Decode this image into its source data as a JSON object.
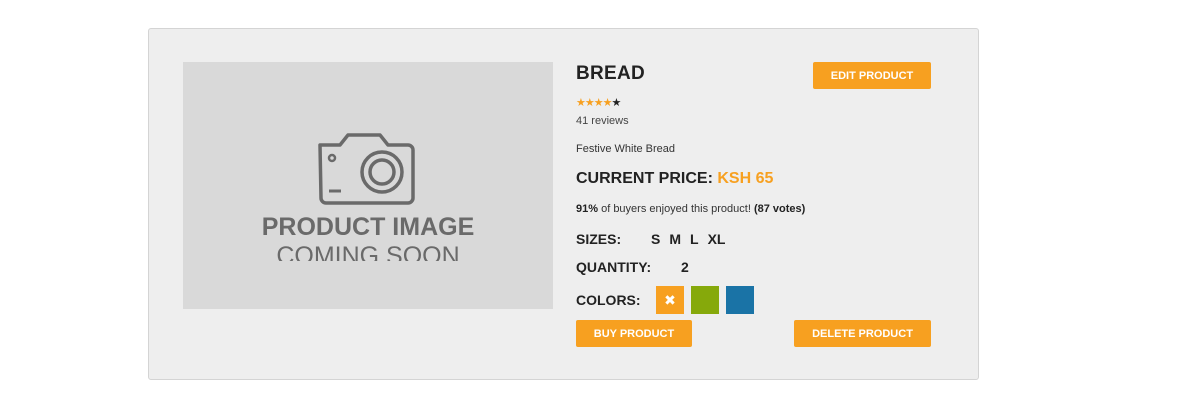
{
  "product": {
    "image_line1": "PRODUCT IMAGE",
    "image_line2": "COMING SOON",
    "title": "BREAD",
    "rating": 4,
    "rating_max": 5,
    "reviews": "41 reviews",
    "description": "Festive White Bread",
    "price_label": "CURRENT PRICE:",
    "price_value": "KSH 65",
    "votes_percent": "91%",
    "votes_text": " of buyers enjoyed this product! ",
    "votes_count": "(87 votes)",
    "sizes_label": "SIZES:",
    "sizes": [
      "S",
      "M",
      "L",
      "XL"
    ],
    "quantity_label": "QUANTITY:",
    "quantity_value": "2",
    "colors_label": "COLORS:",
    "colors": [
      {
        "hex": "#f7a020",
        "selected": true,
        "icon": "close-icon"
      },
      {
        "hex": "#86a90b",
        "selected": false
      },
      {
        "hex": "#1a73a6",
        "selected": false
      }
    ]
  },
  "buttons": {
    "edit": "EDIT PRODUCT",
    "buy": "BUY PRODUCT",
    "delete": "DELETE PRODUCT"
  },
  "theme": {
    "accent": "#f7a020",
    "card_bg": "#eeeeee",
    "image_bg": "#d9d9d9"
  }
}
